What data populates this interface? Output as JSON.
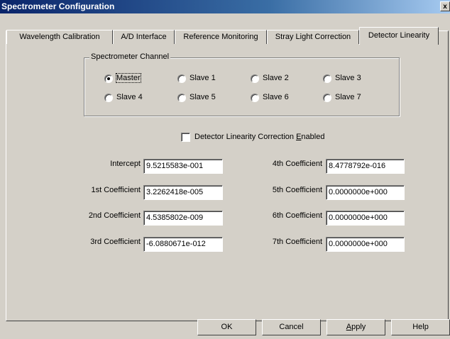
{
  "window": {
    "title": "Spectrometer Configuration",
    "close_glyph": "x"
  },
  "tabs": [
    {
      "label": "Wavelength Calibration"
    },
    {
      "label": "A/D Interface"
    },
    {
      "label": "Reference Monitoring"
    },
    {
      "label": "Stray Light Correction"
    },
    {
      "label": "Detector Linearity",
      "active": true
    }
  ],
  "channel_group": {
    "label": "Spectrometer Channel",
    "options": [
      {
        "label": "Master",
        "selected": true
      },
      {
        "label": "Slave 1"
      },
      {
        "label": "Slave 2"
      },
      {
        "label": "Slave 3"
      },
      {
        "label": "Slave 4"
      },
      {
        "label": "Slave 5"
      },
      {
        "label": "Slave 6"
      },
      {
        "label": "Slave 7"
      }
    ]
  },
  "linearity_checkbox": {
    "label_pre": "Detector Linearity Correction ",
    "label_u": "E",
    "label_post": "nabled",
    "checked": false
  },
  "coefficients_left": [
    {
      "label": "Intercept",
      "value": "9.5215583e-001"
    },
    {
      "label": "1st Coefficient",
      "value": "3.2262418e-005"
    },
    {
      "label": "2nd Coefficient",
      "value": "4.5385802e-009"
    },
    {
      "label": "3rd Coefficient",
      "value": "-6.0880671e-012"
    }
  ],
  "coefficients_right": [
    {
      "label": "4th Coefficient",
      "value": "8.4778792e-016"
    },
    {
      "label": "5th Coefficient",
      "value": "0.0000000e+000"
    },
    {
      "label": "6th Coefficient",
      "value": "0.0000000e+000"
    },
    {
      "label": "7th Coefficient",
      "value": "0.0000000e+000"
    }
  ],
  "buttons": {
    "ok": "OK",
    "cancel": "Cancel",
    "apply_u": "A",
    "apply_rest": "pply",
    "help": "Help"
  }
}
